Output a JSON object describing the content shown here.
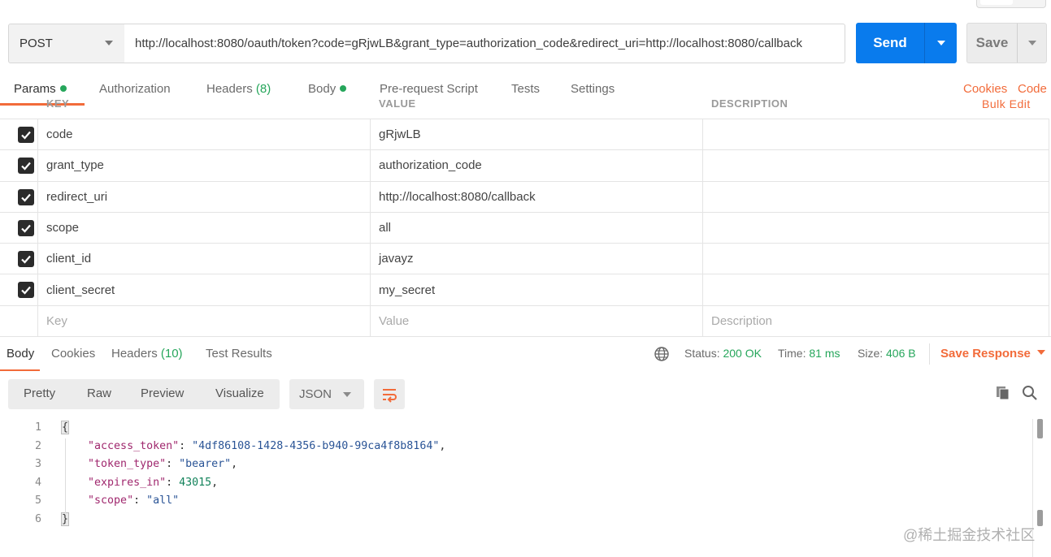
{
  "request": {
    "method": "POST",
    "url": "http://localhost:8080/oauth/token?code=gRjwLB&grant_type=authorization_code&redirect_uri=http://localhost:8080/callback",
    "send_label": "Send",
    "save_label": "Save"
  },
  "request_tabs": [
    {
      "label": "Params",
      "dot": true
    },
    {
      "label": "Authorization"
    },
    {
      "label": "Headers",
      "count": "(8)"
    },
    {
      "label": "Body",
      "dot": true
    },
    {
      "label": "Pre-request Script"
    },
    {
      "label": "Tests"
    },
    {
      "label": "Settings"
    }
  ],
  "request_links": {
    "cookies": "Cookies",
    "code": "Code"
  },
  "params_header": {
    "key": "KEY",
    "value": "VALUE",
    "description": "DESCRIPTION",
    "bulk_edit": "Bulk Edit"
  },
  "params": [
    {
      "key": "code",
      "value": "gRjwLB"
    },
    {
      "key": "grant_type",
      "value": "authorization_code"
    },
    {
      "key": "redirect_uri",
      "value": "http://localhost:8080/callback"
    },
    {
      "key": "scope",
      "value": "all"
    },
    {
      "key": "client_id",
      "value": "javayz"
    },
    {
      "key": "client_secret",
      "value": "my_secret"
    }
  ],
  "params_placeholder": {
    "key": "Key",
    "value": "Value",
    "description": "Description"
  },
  "response_tabs": [
    {
      "label": "Body"
    },
    {
      "label": "Cookies"
    },
    {
      "label": "Headers",
      "count": "(10)"
    },
    {
      "label": "Test Results"
    }
  ],
  "response_status": {
    "status_label": "Status:",
    "status_value": "200 OK",
    "time_label": "Time:",
    "time_value": "81 ms",
    "size_label": "Size:",
    "size_value": "406 B",
    "save_response": "Save Response"
  },
  "format_buttons": [
    "Pretty",
    "Raw",
    "Preview",
    "Visualize"
  ],
  "format_select": "JSON",
  "code_lines": [
    {
      "num": "1",
      "open": "{"
    },
    {
      "num": "2",
      "key": "\"access_token\"",
      "value": "\"4df86108-1428-4356-b940-99ca4f8b8164\"",
      "type": "string",
      "comma": ","
    },
    {
      "num": "3",
      "key": "\"token_type\"",
      "value": "\"bearer\"",
      "type": "string",
      "comma": ","
    },
    {
      "num": "4",
      "key": "\"expires_in\"",
      "value": "43015",
      "type": "number",
      "comma": ","
    },
    {
      "num": "5",
      "key": "\"scope\"",
      "value": "\"all\"",
      "type": "string",
      "comma": ""
    },
    {
      "num": "6",
      "close": "}"
    }
  ],
  "watermark": "@稀土掘金技术社区",
  "colors": {
    "accent": "#f26b3a",
    "send": "#097bed",
    "success": "#26a65b"
  }
}
